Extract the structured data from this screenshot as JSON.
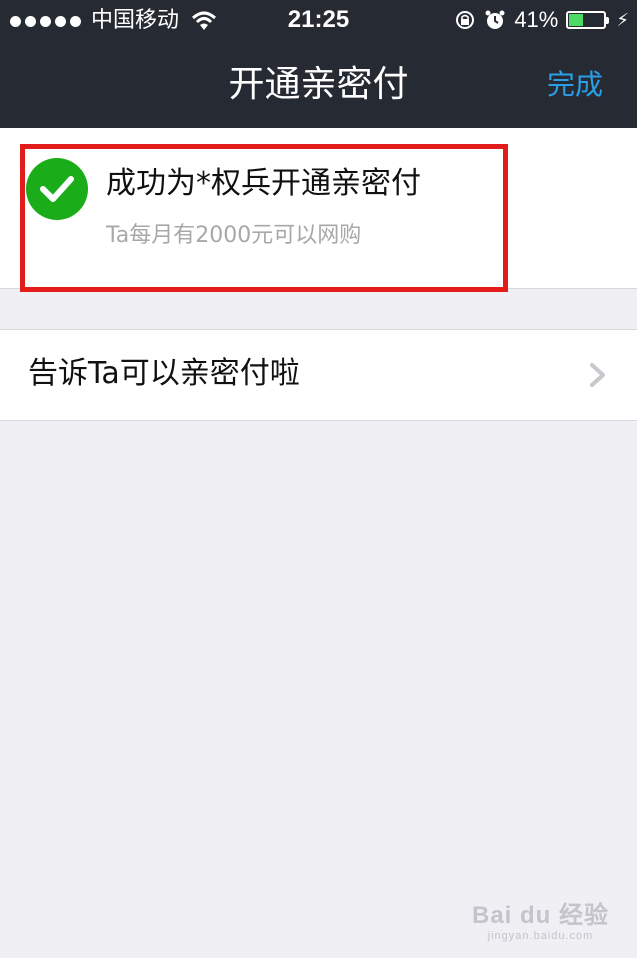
{
  "status_bar": {
    "carrier": "中国移动",
    "time": "21:25",
    "battery_percent": "41%",
    "battery_level": 0.41,
    "icons": [
      "signal-dots-icon",
      "wifi-icon",
      "rotation-lock-icon",
      "alarm-icon",
      "battery-icon",
      "charging-bolt-icon"
    ]
  },
  "nav": {
    "title": "开通亲密付",
    "done_label": "完成"
  },
  "success_card": {
    "icon": "check-circle-icon",
    "title": "成功为*权兵开通亲密付",
    "subtitle": "Ta每月有2000元可以网购",
    "highlight_color": "#e21b1b",
    "check_color": "#1aad19"
  },
  "list": {
    "items": [
      {
        "label": "告诉Ta可以亲密付啦",
        "icon": "chevron-right-icon"
      }
    ]
  },
  "watermark": {
    "main": "Bai du 经验",
    "sub": "jingyan.baidu.com"
  },
  "colors": {
    "nav_background": "#262a33",
    "accent": "#2b9ee6",
    "page_background": "#efeff4"
  }
}
